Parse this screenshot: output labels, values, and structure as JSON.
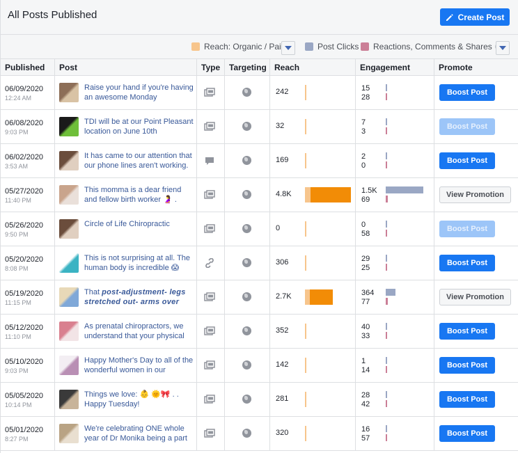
{
  "header": {
    "title": "All Posts Published",
    "create_label": "Create Post"
  },
  "legend": {
    "reach": "Reach: Organic / Paid",
    "clicks": "Post Clicks",
    "reactions": "Reactions, Comments & Shares",
    "colors": {
      "organic": "#f7c58c",
      "paid": "#f28c06",
      "clicks": "#9aa7c4",
      "reactions": "#cb7f97"
    }
  },
  "columns": [
    "Published",
    "Post",
    "Type",
    "Targeting",
    "Reach",
    "Engagement",
    "Promote"
  ],
  "rows": [
    {
      "date": "06/09/2020",
      "time": "12:24 AM",
      "post": "Raise your hand if you're having an awesome Monday",
      "type": "photo-icon",
      "reach": "242",
      "organic_pct": 0.02,
      "paid_pct": 0,
      "eng1": "15",
      "eng2": "28",
      "eng1_pct": 0.01,
      "eng2_pct": 0.01,
      "promote": "Boost Post",
      "promote_state": "active",
      "thumb": [
        "#8d6e57",
        "#d9c3a5"
      ]
    },
    {
      "date": "06/08/2020",
      "time": "9:03 PM",
      "post": "TDI will be at our Point Pleasant location on June 10th",
      "type": "photo-icon",
      "reach": "32",
      "organic_pct": 0.01,
      "paid_pct": 0,
      "eng1": "7",
      "eng2": "3",
      "eng1_pct": 0.005,
      "eng2_pct": 0.005,
      "promote": "Boost Post",
      "promote_state": "disabled",
      "thumb": [
        "#1a1a1a",
        "#6fbf3a"
      ]
    },
    {
      "date": "06/02/2020",
      "time": "3:53 AM",
      "post": "It has came to our attention that our phone lines aren't working.",
      "type": "status-icon",
      "reach": "169",
      "organic_pct": 0.015,
      "paid_pct": 0,
      "eng1": "2",
      "eng2": "0",
      "eng1_pct": 0.005,
      "eng2_pct": 0,
      "promote": "Boost Post",
      "promote_state": "active",
      "thumb": [
        "#6b4d3c",
        "#e0cfc0"
      ]
    },
    {
      "date": "05/27/2020",
      "time": "11:40 PM",
      "post": "This momma is a dear friend and fellow birth worker 🤰 .",
      "type": "photo-icon",
      "reach": "4.8K",
      "organic_pct": 0.12,
      "paid_pct": 0.88,
      "eng1": "1.5K",
      "eng2": "69",
      "eng1_pct": 1.0,
      "eng2_pct": 0.05,
      "promote": "View Promotion",
      "promote_state": "view",
      "thumb": [
        "#c9a48c",
        "#eae0da"
      ]
    },
    {
      "date": "05/26/2020",
      "time": "9:50 PM",
      "post": "Circle of Life Chiropractic",
      "type": "photo-icon",
      "reach": "0",
      "organic_pct": 0.0,
      "paid_pct": 0,
      "eng1": "0",
      "eng2": "58",
      "eng1_pct": 0.0,
      "eng2_pct": 0.03,
      "promote": "Boost Post",
      "promote_state": "disabled",
      "thumb": [
        "#6b4d3c",
        "#e0cfc0"
      ]
    },
    {
      "date": "05/20/2020",
      "time": "8:08 PM",
      "post": "This is not surprising at all. The human body is incredible 😱",
      "type": "link-icon",
      "reach": "306",
      "organic_pct": 0.025,
      "paid_pct": 0,
      "eng1": "29",
      "eng2": "25",
      "eng1_pct": 0.015,
      "eng2_pct": 0.015,
      "promote": "Boost Post",
      "promote_state": "active",
      "thumb": [
        "#ffffff",
        "#3bb3c3"
      ]
    },
    {
      "date": "05/19/2020",
      "time": "11:15 PM",
      "post": "That",
      "post_em": "post-adjustment- legs stretched out- arms over",
      "type": "photo-icon",
      "reach": "2.7K",
      "organic_pct": 0.1,
      "paid_pct": 0.5,
      "eng1": "364",
      "eng2": "77",
      "eng1_pct": 0.25,
      "eng2_pct": 0.05,
      "promote": "View Promotion",
      "promote_state": "view",
      "thumb": [
        "#e8d9b8",
        "#7fa8d8"
      ]
    },
    {
      "date": "05/12/2020",
      "time": "11:10 PM",
      "post": "As prenatal chiropractors, we understand that your physical",
      "type": "photo-icon",
      "reach": "352",
      "organic_pct": 0.03,
      "paid_pct": 0,
      "eng1": "40",
      "eng2": "33",
      "eng1_pct": 0.02,
      "eng2_pct": 0.02,
      "promote": "Boost Post",
      "promote_state": "active",
      "thumb": [
        "#d9808f",
        "#f2e4e6"
      ]
    },
    {
      "date": "05/10/2020",
      "time": "9:03 PM",
      "post": "Happy Mother's Day to all of the wonderful women in our",
      "type": "photo-icon",
      "reach": "142",
      "organic_pct": 0.015,
      "paid_pct": 0,
      "eng1": "1",
      "eng2": "14",
      "eng1_pct": 0.005,
      "eng2_pct": 0.01,
      "promote": "Boost Post",
      "promote_state": "active",
      "thumb": [
        "#f3eef3",
        "#b98fb4"
      ]
    },
    {
      "date": "05/05/2020",
      "time": "10:14 PM",
      "post": "Things we love: 👶 🌞🎀 . . Happy Tuesday!",
      "type": "photo-icon",
      "reach": "281",
      "organic_pct": 0.025,
      "paid_pct": 0,
      "eng1": "28",
      "eng2": "42",
      "eng1_pct": 0.015,
      "eng2_pct": 0.02,
      "promote": "Boost Post",
      "promote_state": "active",
      "thumb": [
        "#3a3a3a",
        "#c8b49a"
      ]
    },
    {
      "date": "05/01/2020",
      "time": "8:27 PM",
      "post": "We're celebrating ONE whole year of Dr Monika being a part",
      "type": "photo-icon",
      "reach": "320",
      "organic_pct": 0.025,
      "paid_pct": 0,
      "eng1": "16",
      "eng2": "57",
      "eng1_pct": 0.01,
      "eng2_pct": 0.03,
      "promote": "Boost Post",
      "promote_state": "active",
      "thumb": [
        "#b9a384",
        "#e9dfd0"
      ]
    }
  ]
}
